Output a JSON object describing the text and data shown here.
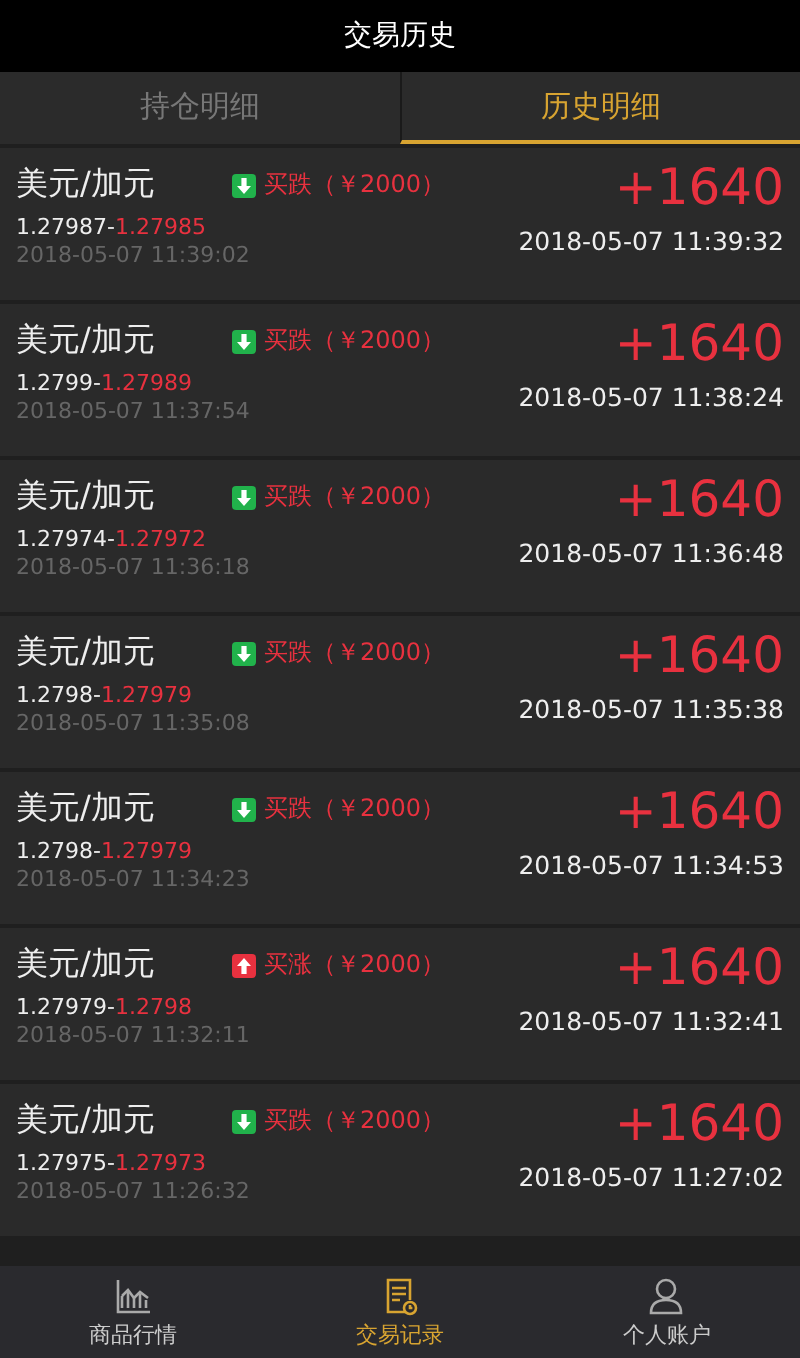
{
  "header": {
    "title": "交易历史"
  },
  "tabs": [
    {
      "label": "持仓明细",
      "selected": false
    },
    {
      "label": "历史明细",
      "selected": true
    }
  ],
  "trades": [
    {
      "pair": "美元/加元",
      "kind": "down",
      "side": "买跌",
      "stake": "（￥2000）",
      "open_price": "1.27987-",
      "close_price": "1.27985",
      "open_time": "2018-05-07 11:39:02",
      "profit": "+1640",
      "close_time": "2018-05-07 11:39:32"
    },
    {
      "pair": "美元/加元",
      "kind": "down",
      "side": "买跌",
      "stake": "（￥2000）",
      "open_price": "1.2799-",
      "close_price": "1.27989",
      "open_time": "2018-05-07 11:37:54",
      "profit": "+1640",
      "close_time": "2018-05-07 11:38:24"
    },
    {
      "pair": "美元/加元",
      "kind": "down",
      "side": "买跌",
      "stake": "（￥2000）",
      "open_price": "1.27974-",
      "close_price": "1.27972",
      "open_time": "2018-05-07 11:36:18",
      "profit": "+1640",
      "close_time": "2018-05-07 11:36:48"
    },
    {
      "pair": "美元/加元",
      "kind": "down",
      "side": "买跌",
      "stake": "（￥2000）",
      "open_price": "1.2798-",
      "close_price": "1.27979",
      "open_time": "2018-05-07 11:35:08",
      "profit": "+1640",
      "close_time": "2018-05-07 11:35:38"
    },
    {
      "pair": "美元/加元",
      "kind": "down",
      "side": "买跌",
      "stake": "（￥2000）",
      "open_price": "1.2798-",
      "close_price": "1.27979",
      "open_time": "2018-05-07 11:34:23",
      "profit": "+1640",
      "close_time": "2018-05-07 11:34:53"
    },
    {
      "pair": "美元/加元",
      "kind": "up",
      "side": "买涨",
      "stake": "（￥2000）",
      "open_price": "1.27979-",
      "close_price": "1.2798",
      "open_time": "2018-05-07 11:32:11",
      "profit": "+1640",
      "close_time": "2018-05-07 11:32:41"
    },
    {
      "pair": "美元/加元",
      "kind": "down",
      "side": "买跌",
      "stake": "（￥2000）",
      "open_price": "1.27975-",
      "close_price": "1.27973",
      "open_time": "2018-05-07 11:26:32",
      "profit": "+1640",
      "close_time": "2018-05-07 11:27:02"
    }
  ],
  "nav": [
    {
      "kind": "chart",
      "label": "商品行情",
      "selected": false
    },
    {
      "kind": "records",
      "label": "交易记录",
      "selected": true
    },
    {
      "kind": "person",
      "label": "个人账户",
      "selected": false
    }
  ]
}
